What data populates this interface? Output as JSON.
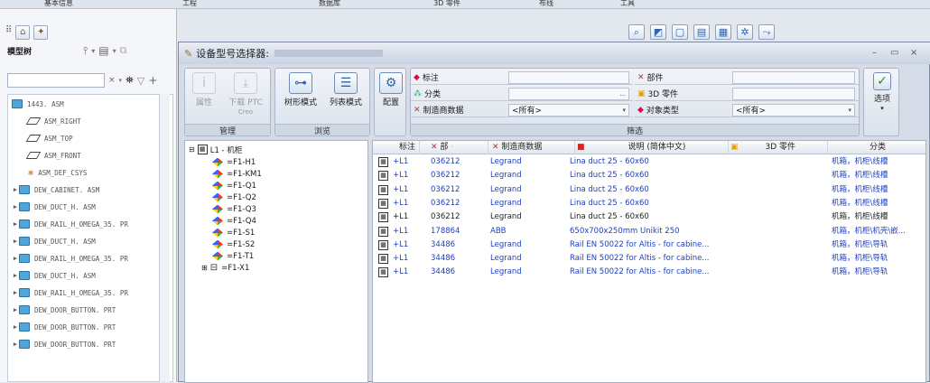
{
  "top_menu": [
    "基本信息",
    "工程",
    "数据库",
    "3D 零件",
    "布线",
    "工具"
  ],
  "left_panel": {
    "tree_title": "模型树",
    "search_value": "",
    "items": [
      {
        "label": "1443. ASM",
        "icon": "assembly-icon"
      },
      {
        "label": "ASM_RIGHT",
        "icon": "datum-plane-icon"
      },
      {
        "label": "ASM_TOP",
        "icon": "datum-plane-icon"
      },
      {
        "label": "ASM_FRONT",
        "icon": "datum-plane-icon"
      },
      {
        "label": "ASM_DEF_CSYS",
        "icon": "csys-icon"
      },
      {
        "label": "DEW_CABINET. ASM",
        "icon": "assembly-icon"
      },
      {
        "label": "DEW_DUCT_H. ASM",
        "icon": "assembly-icon"
      },
      {
        "label": "DEW_RAIL_H_OMEGA_35. PR",
        "icon": "assembly-icon"
      },
      {
        "label": "DEW_DUCT_H. ASM",
        "icon": "assembly-icon"
      },
      {
        "label": "DEW_RAIL_H_OMEGA_35. PR",
        "icon": "assembly-icon"
      },
      {
        "label": "DEW_DUCT_H. ASM",
        "icon": "assembly-icon"
      },
      {
        "label": "DEW_RAIL_H_OMEGA_35. PR",
        "icon": "assembly-icon"
      },
      {
        "label": "DEW_DOOR_BUTTON. PRT",
        "icon": "part-icon"
      },
      {
        "label": "DEW_DOOR_BUTTON. PRT",
        "icon": "part-icon"
      },
      {
        "label": "DEW_DOOR_BUTTON. PRT",
        "icon": "part-icon"
      }
    ]
  },
  "dialog": {
    "title": "设备型号选择器:",
    "ribbon": {
      "manage": {
        "label": "管理",
        "attr": "属性",
        "download": "下载 PTC",
        "download_sub": "Creo"
      },
      "browse": {
        "label": "浏览",
        "tree_mode": "树形模式",
        "list_mode": "列表模式"
      },
      "config": "配置",
      "filter": {
        "label": "筛选",
        "tag": "标注",
        "category": "分类",
        "manufacturer": "制造商数据",
        "manufacturer_value": "<所有>",
        "part": "部件",
        "part3d": "3D 零件",
        "object_type": "对象类型",
        "object_type_value": "<所有>",
        "ellipsis": "..."
      },
      "options": "选项"
    },
    "tree": {
      "root": "L1 - 机柜",
      "nodes": [
        "=F1-H1",
        "=F1-KM1",
        "=F1-Q1",
        "=F1-Q2",
        "=F1-Q3",
        "=F1-Q4",
        "=F1-S1",
        "=F1-S2",
        "=F1-T1",
        "=F1-X1"
      ]
    },
    "grid": {
      "headers": {
        "tag": "标注",
        "part": "部",
        "manufacturer": "制造商数据",
        "desc": "说明 (简体中文)",
        "part3d": "3D 零件",
        "category": "分类"
      },
      "rows": [
        {
          "tag": "+L1",
          "part": "036212",
          "mfr": "Legrand",
          "desc": "Lina duct 25 - 60x60",
          "cat": "机箱，机柜\\线槽",
          "style": "blue"
        },
        {
          "tag": "+L1",
          "part": "036212",
          "mfr": "Legrand",
          "desc": "Lina duct 25 - 60x60",
          "cat": "机箱，机柜\\线槽",
          "style": "blue"
        },
        {
          "tag": "+L1",
          "part": "036212",
          "mfr": "Legrand",
          "desc": "Lina duct 25 - 60x60",
          "cat": "机箱，机柜\\线槽",
          "style": "blue"
        },
        {
          "tag": "+L1",
          "part": "036212",
          "mfr": "Legrand",
          "desc": "Lina duct 25 - 60x60",
          "cat": "机箱，机柜\\线槽",
          "style": "blue"
        },
        {
          "tag": "+L1",
          "part": "036212",
          "mfr": "Legrand",
          "desc": "Lina duct 25 - 60x60",
          "cat": "机箱，机柜\\线槽",
          "style": "dark"
        },
        {
          "tag": "+L1",
          "part": "178864",
          "mfr": "ABB",
          "desc": "650x700x250mm Unikit 250",
          "cat": "机箱，机柜\\机壳\\嵌...",
          "style": "blue"
        },
        {
          "tag": "+L1",
          "part": "34486",
          "mfr": "Legrand",
          "desc": "Rail EN 50022 for Altis - for cabine...",
          "cat": "机箱，机柜\\导轨",
          "style": "blue"
        },
        {
          "tag": "+L1",
          "part": "34486",
          "mfr": "Legrand",
          "desc": "Rail EN 50022 for Altis - for cabine...",
          "cat": "机箱，机柜\\导轨",
          "style": "blue"
        },
        {
          "tag": "+L1",
          "part": "34486",
          "mfr": "Legrand",
          "desc": "Rail EN 50022 for Altis - for cabine...",
          "cat": "机箱，机柜\\导轨",
          "style": "blue"
        }
      ]
    }
  }
}
